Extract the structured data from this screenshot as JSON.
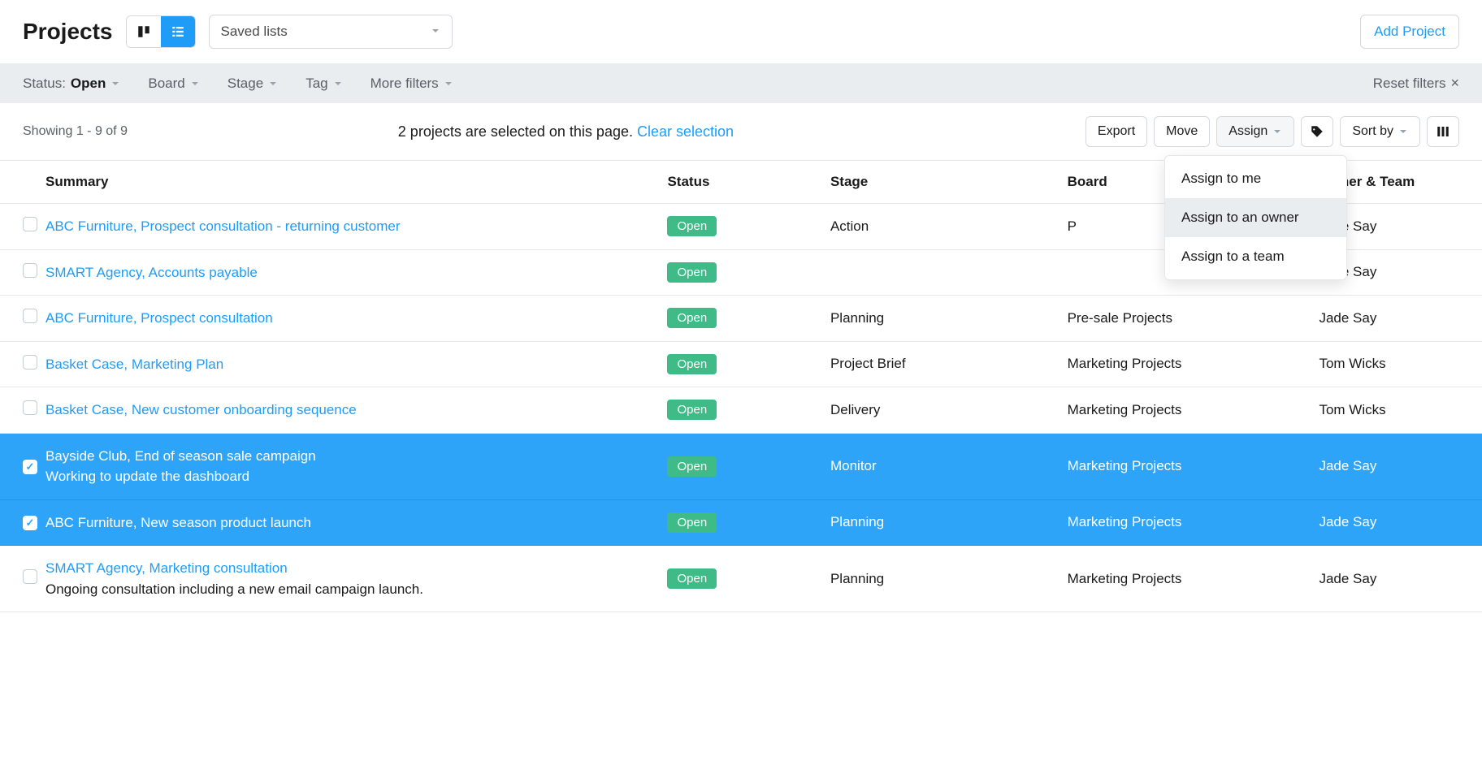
{
  "header": {
    "title": "Projects",
    "saved_lists_label": "Saved lists",
    "add_project_label": "Add Project"
  },
  "filters": {
    "status_label": "Status:",
    "status_value": "Open",
    "board_label": "Board",
    "stage_label": "Stage",
    "tag_label": "Tag",
    "more_label": "More filters",
    "reset_label": "Reset filters"
  },
  "subheader": {
    "showing_text": "Showing 1 - 9 of 9",
    "selection_text": "2 projects are selected on this page.",
    "clear_selection_label": "Clear selection",
    "export_label": "Export",
    "move_label": "Move",
    "assign_label": "Assign",
    "sort_label": "Sort by"
  },
  "assign_menu": {
    "item0": "Assign to me",
    "item1": "Assign to an owner",
    "item2": "Assign to a team"
  },
  "columns": {
    "summary": "Summary",
    "status": "Status",
    "stage": "Stage",
    "board": "Board",
    "owner": "Owner & Team"
  },
  "rows": [
    {
      "selected": false,
      "summary": "ABC Furniture, Prospect consultation - returning customer",
      "sub": "",
      "status": "Open",
      "stage": "Action",
      "board": "P",
      "owner": "Jade Say"
    },
    {
      "selected": false,
      "summary": "SMART Agency, Accounts payable",
      "sub": "",
      "status": "Open",
      "stage": "",
      "board": "",
      "owner": "Jade Say"
    },
    {
      "selected": false,
      "summary": "ABC Furniture, Prospect consultation",
      "sub": "",
      "status": "Open",
      "stage": "Planning",
      "board": "Pre-sale Projects",
      "owner": "Jade Say"
    },
    {
      "selected": false,
      "summary": "Basket Case, Marketing Plan",
      "sub": "",
      "status": "Open",
      "stage": "Project Brief",
      "board": "Marketing Projects",
      "owner": "Tom Wicks"
    },
    {
      "selected": false,
      "summary": "Basket Case, New customer onboarding sequence",
      "sub": "",
      "status": "Open",
      "stage": "Delivery",
      "board": "Marketing Projects",
      "owner": "Tom Wicks"
    },
    {
      "selected": true,
      "summary": "Bayside Club, End of season sale campaign",
      "sub": "Working to update the dashboard",
      "status": "Open",
      "stage": "Monitor",
      "board": "Marketing Projects",
      "owner": "Jade Say"
    },
    {
      "selected": true,
      "summary": "ABC Furniture, New season product launch",
      "sub": "",
      "status": "Open",
      "stage": "Planning",
      "board": "Marketing Projects",
      "owner": "Jade Say"
    },
    {
      "selected": false,
      "summary": "SMART Agency, Marketing consultation",
      "sub": "Ongoing consultation including a new email campaign launch.",
      "status": "Open",
      "stage": "Planning",
      "board": "Marketing Projects",
      "owner": "Jade Say"
    }
  ]
}
